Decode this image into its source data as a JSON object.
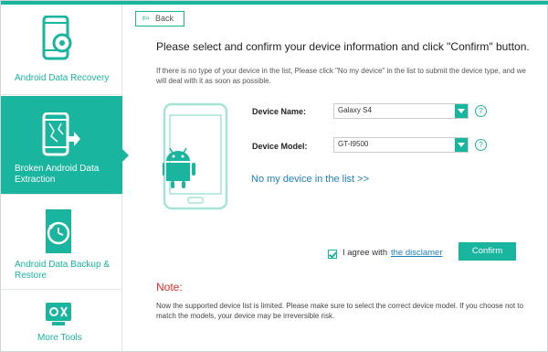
{
  "sidebar": {
    "items": [
      {
        "label": "Android Data Recovery",
        "icon": "phone-recovery-icon",
        "active": false
      },
      {
        "label": "Broken Android Data Extraction",
        "icon": "broken-phone-icon",
        "active": true
      },
      {
        "label": "Android Data Backup & Restore",
        "icon": "backup-restore-icon",
        "active": false
      },
      {
        "label": "More Tools",
        "icon": "toolbox-icon",
        "active": false
      }
    ]
  },
  "main": {
    "back_label": "Back",
    "heading": "Please select and confirm your device information and click \"Confirm\" button.",
    "hint": "If there is no type of your device in the list, Please click \"No my device\" in the list to submit the device type, and we will deal with it as soon as possible.",
    "device_name_label": "Device Name:",
    "device_name_value": "Galaxy S4",
    "device_model_label": "Device Model:",
    "device_model_value": "GT-I9500",
    "help_symbol": "?",
    "no_device_link": "No my device in the list >>",
    "agree_text": "I agree with",
    "disclaimer_link": "the disclamer",
    "agree_checked": true,
    "confirm_label": "Confirm",
    "note_title": "Note:",
    "note_text": "Now the supported device list is limited. Please make sure to select the correct device model. If you choose not to match the models, your device may be irreversible risk."
  },
  "colors": {
    "accent": "#1ab59f",
    "link": "#1e7fbf",
    "note": "#e0302a"
  }
}
